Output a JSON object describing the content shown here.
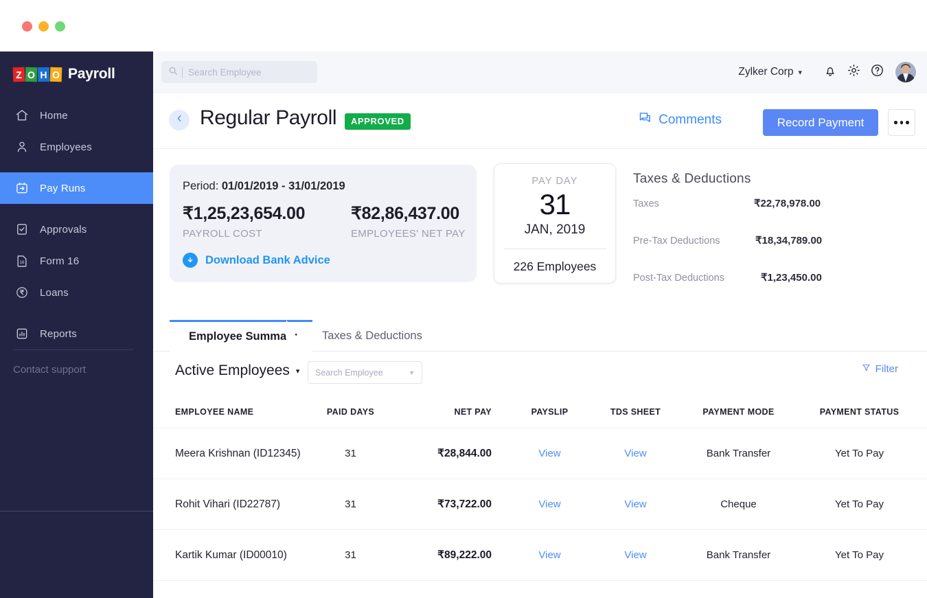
{
  "window": {
    "lights": [
      "close",
      "minimize",
      "maximize"
    ]
  },
  "sidebar": {
    "logo": {
      "tiles": [
        "Z",
        "O",
        "H",
        "O"
      ],
      "word": "Payroll"
    },
    "items": [
      {
        "label": "Home",
        "icon": "home-icon",
        "active": false
      },
      {
        "label": "Employees",
        "icon": "user-icon",
        "active": false
      },
      {
        "label": "Pay Runs",
        "icon": "pay-runs-icon",
        "active": true
      },
      {
        "label": "Approvals",
        "icon": "approvals-check-icon",
        "active": false
      },
      {
        "label": "Form 16",
        "icon": "form16-icon",
        "active": false
      },
      {
        "label": "Loans",
        "icon": "rupee-circle-icon",
        "active": false
      },
      {
        "label": "Reports",
        "icon": "bar-chart-icon",
        "active": false
      }
    ],
    "support": "Contact support"
  },
  "topbar": {
    "search_placeholder": "Search Employee",
    "org": "Zylker Corp",
    "icons": [
      "bell-icon",
      "gear-icon",
      "help-icon"
    ]
  },
  "header": {
    "title": "Regular Payroll",
    "status_badge": "APPROVED",
    "comments": "Comments",
    "record_payment": "Record Payment",
    "more": "•••"
  },
  "summary": {
    "period_label": "Period:",
    "period_value": "01/01/2019 - 31/01/2019",
    "payroll_cost": {
      "amount": "₹1,25,23,654.00",
      "label": "PAYROLL COST"
    },
    "net_pay": {
      "amount": "₹82,86,437.00",
      "label": "EMPLOYEES' NET PAY"
    },
    "download_link": "Download Bank Advice",
    "payday": {
      "label": "PAY DAY",
      "day": "31",
      "month_year": "JAN, 2019",
      "employees": "226 Employees"
    },
    "taxes": {
      "title": "Taxes & Deductions",
      "rows": [
        {
          "name": "Taxes",
          "value": "₹22,78,978.00"
        },
        {
          "name": "Pre-Tax Deductions",
          "value": "₹18,34,789.00"
        },
        {
          "name": "Post-Tax Deductions",
          "value": "₹1,23,450.00"
        }
      ]
    }
  },
  "tabs": [
    {
      "label": "Employee Summary",
      "active": true
    },
    {
      "label": "Taxes & Deductions",
      "active": false
    }
  ],
  "filters": {
    "view": "Active Employees",
    "search_placeholder": "Search Employee",
    "filter_label": "Filter"
  },
  "table": {
    "columns": [
      "EMPLOYEE NAME",
      "PAID DAYS",
      "NET PAY",
      "PAYSLIP",
      "TDS SHEET",
      "PAYMENT MODE",
      "PAYMENT STATUS"
    ],
    "rows": [
      {
        "name": "Meera Krishnan (ID12345)",
        "paid_days": "31",
        "net_pay": "₹28,844.00",
        "payslip": "View",
        "tds_sheet": "View",
        "payment_mode": "Bank Transfer",
        "payment_status": "Yet To Pay"
      },
      {
        "name": "Rohit Vihari (ID22787)",
        "paid_days": "31",
        "net_pay": "₹73,722.00",
        "payslip": "View",
        "tds_sheet": "View",
        "payment_mode": "Cheque",
        "payment_status": "Yet To Pay"
      },
      {
        "name": "Kartik Kumar (ID00010)",
        "paid_days": "31",
        "net_pay": "₹89,222.00",
        "payslip": "View",
        "tds_sheet": "View",
        "payment_mode": "Bank Transfer",
        "payment_status": "Yet To Pay"
      }
    ]
  },
  "colors": {
    "sidebar_bg": "#232444",
    "accent_blue": "#4d8df9",
    "primary_button": "#5b87f5",
    "badge_green": "#12ac4a",
    "link_blue": "#2196f3",
    "card_bg": "#f1f2f7"
  }
}
